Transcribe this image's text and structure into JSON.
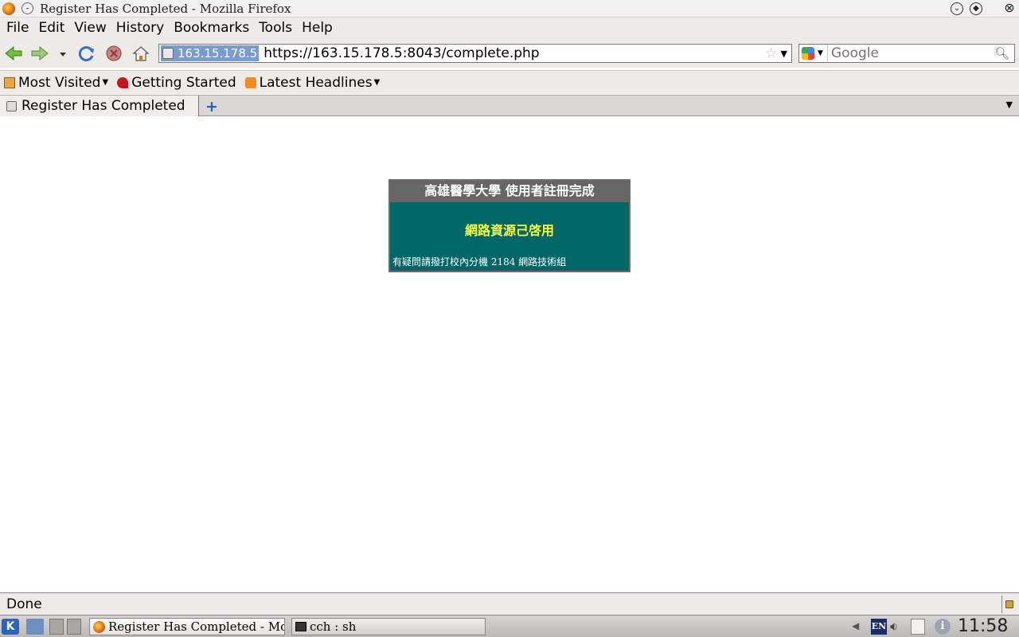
{
  "window": {
    "title": "Register Has Completed - Mozilla Firefox"
  },
  "menubar": {
    "items": [
      "File",
      "Edit",
      "View",
      "History",
      "Bookmarks",
      "Tools",
      "Help"
    ]
  },
  "navbar": {
    "site_identity": "163.15.178.5",
    "url": "https://163.15.178.5:8043/complete.php",
    "search_placeholder": "Google"
  },
  "bookmarks": {
    "most_visited": "Most Visited",
    "getting_started": "Getting Started",
    "latest_headlines": "Latest Headlines"
  },
  "tabs": {
    "active_label": "Register Has Completed"
  },
  "page": {
    "header": "高雄醫學大學 使用者註冊完成",
    "message": "網路資源己啓用",
    "footer": "有疑問請撥打校內分機 2184 網路技術組"
  },
  "status": {
    "text": "Done"
  },
  "taskbar": {
    "task_firefox": "Register Has Completed - Mozilla Firefox",
    "task_terminal": "cch : sh",
    "kbd_layout": "EN",
    "info": "i",
    "clock": "11:58"
  }
}
